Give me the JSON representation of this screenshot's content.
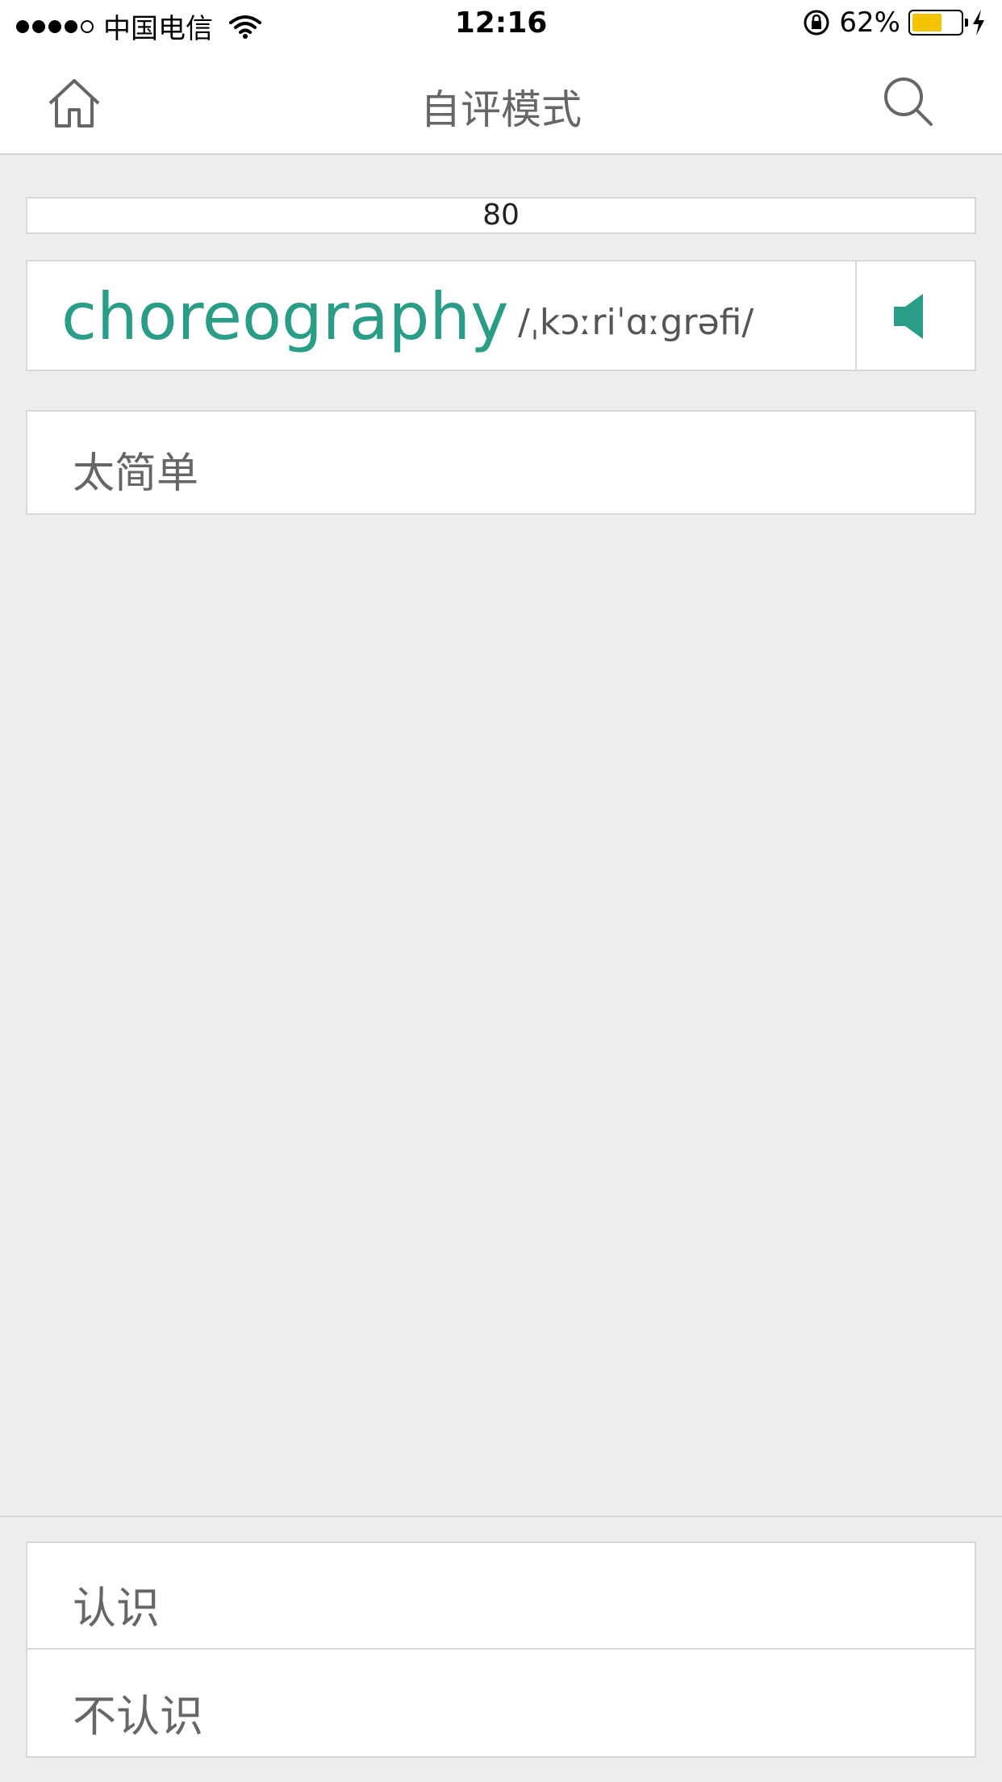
{
  "status_bar": {
    "carrier": "中国电信",
    "time": "12:16",
    "battery_percent_label": "62%",
    "battery_level": 0.62,
    "icons": [
      "signal-dots-icon",
      "wifi-icon",
      "rotation-lock-icon",
      "battery-icon",
      "charging-bolt-icon"
    ]
  },
  "nav": {
    "title": "自评模式",
    "left_icon": "home-icon",
    "right_icon": "search-icon"
  },
  "counter": {
    "value": "80"
  },
  "word_card": {
    "word": "choreography",
    "phonetic": "/ˌkɔːriˈɑːgrəfi/",
    "audio_icon": "speaker-icon"
  },
  "hint": {
    "label": "太简单"
  },
  "answers": {
    "know_label": "认识",
    "dont_know_label": "不认识"
  },
  "colors": {
    "accent": "#2a9d86",
    "background": "#eeeeee",
    "battery": "#f5c400"
  }
}
